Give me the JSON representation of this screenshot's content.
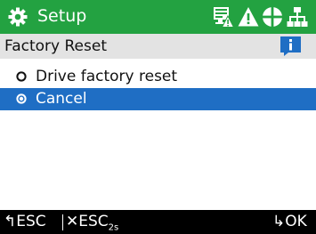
{
  "header": {
    "title": "Setup",
    "accent_color": "#23a241",
    "status_icons": [
      "monitor-warning-icon",
      "warning-triangle-icon",
      "globe-icon",
      "network-icon"
    ]
  },
  "subheader": {
    "title": "Factory Reset",
    "info_icon": "info-icon"
  },
  "menu": {
    "items": [
      {
        "label": "Drive factory reset",
        "selected": false
      },
      {
        "label": "Cancel",
        "selected": true
      }
    ],
    "selected_color": "#1f6ec4"
  },
  "footer": {
    "back_label": "ESC",
    "exit_label": "ESC",
    "exit_sub": "2s",
    "ok_label": "OK"
  }
}
